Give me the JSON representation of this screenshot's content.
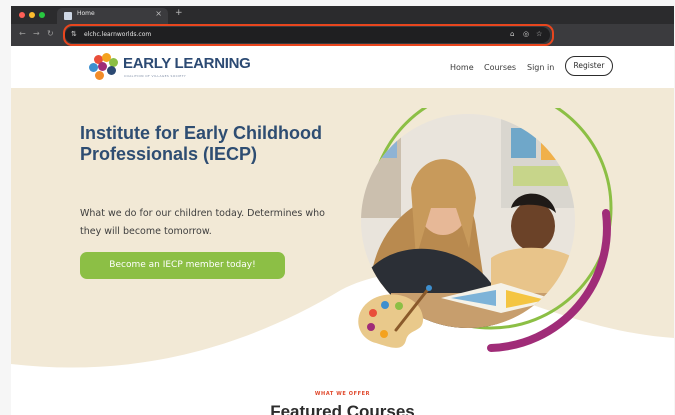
{
  "browser": {
    "tab_title": "Home",
    "url": "elchc.learnworlds.com",
    "new_tab_symbol": "+",
    "tab_close_symbol": "×",
    "traffic_lights": {
      "close": "#ff5f57",
      "minimize": "#febc2e",
      "maximize": "#28c840"
    },
    "highlight_color": "#e8461e"
  },
  "header": {
    "logo_text": "EARLY LEARNING",
    "logo_tagline": "COALITION OF VILLAGES SOCIETY",
    "nav": [
      {
        "label": "Home"
      },
      {
        "label": "Courses"
      },
      {
        "label": "Sign in"
      }
    ],
    "register_label": "Register"
  },
  "hero": {
    "headline": "Institute for Early Childhood Professionals (IECP)",
    "subtext": "What we do for our children today. Determines who they will become tomorrow.",
    "cta_label": "Become an IECP member today!",
    "colors": {
      "background": "#f2e9d6",
      "headline": "#2e4d72",
      "cta": "#8cbf45",
      "ring_green": "#8cbf45",
      "ring_magenta": "#a02c78"
    }
  },
  "featured": {
    "kicker": "WHAT WE OFFER",
    "title": "Featured Courses"
  }
}
